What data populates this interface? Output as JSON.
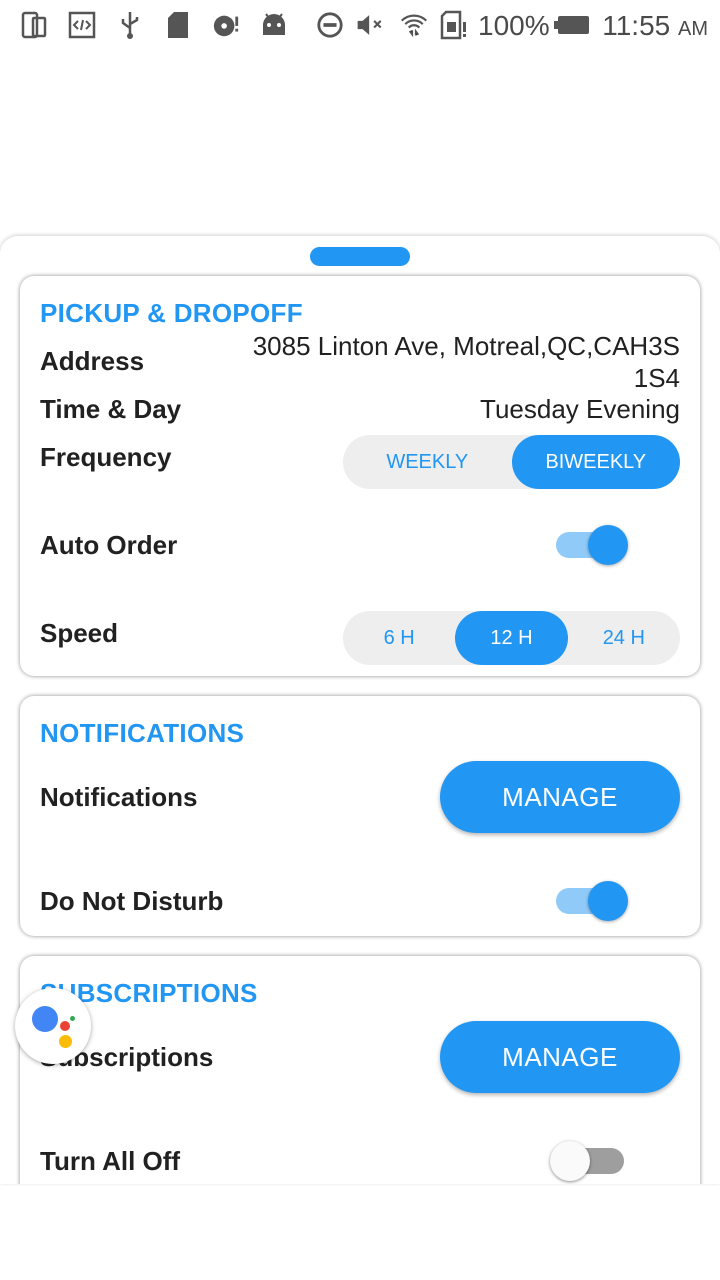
{
  "status_bar": {
    "icons": [
      "device-icon",
      "code-icon",
      "usb-icon",
      "sd-card-icon",
      "disk-icon",
      "android-icon",
      "do-not-disturb-icon",
      "mute-icon",
      "wifi-icon",
      "sim-icon",
      "battery-icon"
    ],
    "battery_percent": "100%",
    "time": "11:55",
    "ampm": "AM"
  },
  "pickup": {
    "title": "PICKUP & DROPOFF",
    "address_label": "Address",
    "address_line1": "3085 Linton Ave, Motreal,QC,CAH3S",
    "address_line2": "1S4",
    "time_label": "Time & Day",
    "time_value": "Tuesday Evening",
    "frequency_label": "Frequency",
    "frequency_options": [
      "WEEKLY",
      "BIWEEKLY"
    ],
    "frequency_selected": "BIWEEKLY",
    "auto_order_label": "Auto Order",
    "auto_order_on": true,
    "speed_label": "Speed",
    "speed_options": [
      "6 H",
      "12 H",
      "24 H"
    ],
    "speed_selected": "12 H"
  },
  "notifications": {
    "title": "NOTIFICATIONS",
    "notifications_label": "Notifications",
    "manage_label": "MANAGE",
    "dnd_label": "Do Not Disturb",
    "dnd_on": true
  },
  "subscriptions": {
    "title": "SUBSCRIPTIONS",
    "subscriptions_label": "Subscriptions",
    "manage_label": "MANAGE",
    "turn_all_off_label": "Turn All Off",
    "turn_all_off_on": false
  },
  "colors": {
    "accent": "#2196f3",
    "accent_light": "#90caf9",
    "segment_bg": "#eeeeee"
  }
}
